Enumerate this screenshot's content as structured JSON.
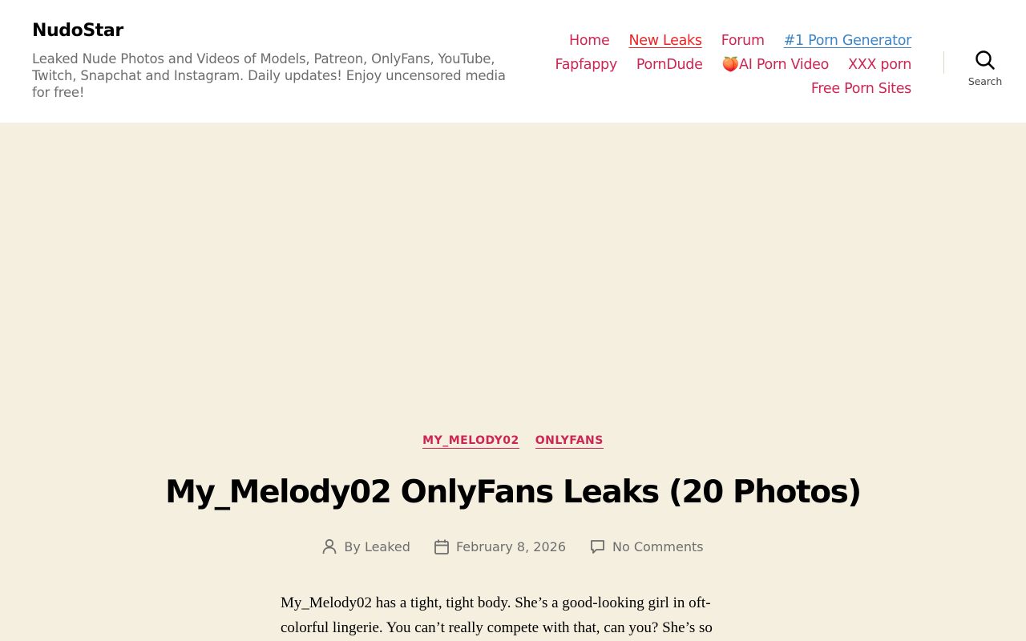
{
  "site": {
    "title": "NudoStar",
    "description": "Leaked Nude Photos and Videos of Models, Patreon, OnlyFans, YouTube, Twitch, Snapchat and Instagram. Daily updates! Enjoy uncensored media for free!"
  },
  "nav": {
    "row1": [
      "Home",
      "New Leaks",
      "Forum",
      "#1 Porn Generator"
    ],
    "row2": [
      "Fapfappy",
      "PornDude",
      "🍑AI Porn Video",
      "XXX porn"
    ],
    "row3": [
      "Free Porn Sites"
    ]
  },
  "search": {
    "label": "Search",
    "icon": "search-icon"
  },
  "post": {
    "categories": [
      "MY_MELODY02",
      "ONLYFANS"
    ],
    "title": "My_Melody02 OnlyFans Leaks (20 Photos)",
    "author": "By Leaked",
    "date": "February 8, 2026",
    "comments": "No Comments",
    "excerpt": "My_Melody02 has a tight, tight body. She’s a good-looking girl in oft-colorful lingerie. You can’t really compete with that, can you? She’s so"
  },
  "colors": {
    "accent": "#cd2653",
    "background": "#f5efe0",
    "header_bg": "#ffffff"
  }
}
